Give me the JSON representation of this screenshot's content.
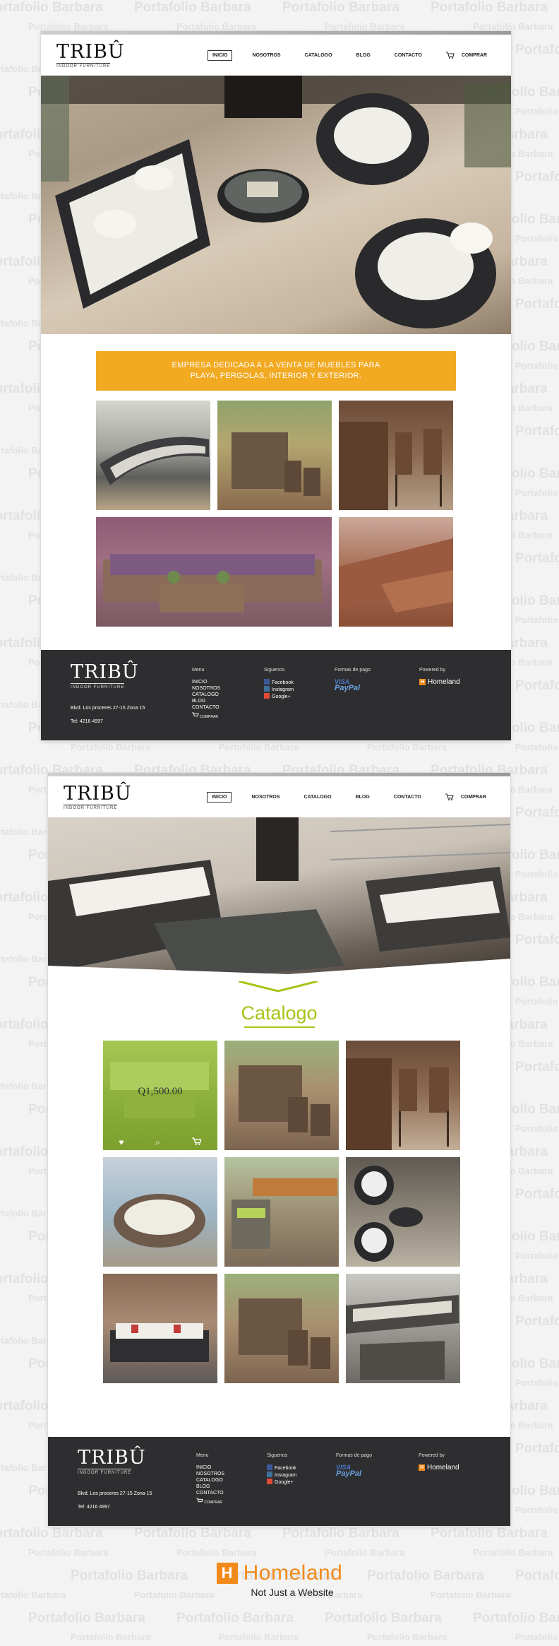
{
  "watermark_text": "Portafolio Barbara",
  "colors": {
    "accent_orange": "#f2aa23",
    "catalog_green": "#a8c316",
    "footer_bg": "#2e2e30",
    "homeland_orange": "#f28a1a"
  },
  "brand": {
    "logo": "TRIBÛ",
    "tagline": "INDOOR FURNITURE"
  },
  "nav": {
    "items": [
      "INICIO",
      "NOSOTROS",
      "CATALOGO",
      "BLOG",
      "CONTACTO"
    ],
    "cart_label": "COMPRAR",
    "cart_icon": "cart-icon"
  },
  "page1": {
    "banner_line1": "EMPRESA DEDICADA A LA VENTA DE MUEBLES PARA",
    "banner_line2": "PLAYA, PERGOLAS, INTERIOR Y EXTERIOR."
  },
  "footer": {
    "address": "Blvd. Los proceres 27-15 Zona 15",
    "phone": "Tel: 4216 4997",
    "menu_title": "Menu",
    "menu_items": [
      "INICIO",
      "NOSOTROS",
      "CATALOGO",
      "BLOG",
      "CONTACTO"
    ],
    "cart_label": "COMPRAR",
    "social_title": "Siguenos",
    "social": [
      "Facebook",
      "Instagram",
      "Google+"
    ],
    "payment_title": "Formas de pago",
    "payment": [
      "VISA",
      "PayPal"
    ],
    "powered_title": "Powered by",
    "powered_brand": "Homeland",
    "powered_box": "H"
  },
  "page2": {
    "catalog_title": "Catalogo",
    "featured_price": "Q1,500.00",
    "product_actions": [
      "heart-icon",
      "search-icon",
      "cart-icon"
    ]
  },
  "homeland_logo": {
    "box": "H",
    "name": "Homeland",
    "tagline": "Not Just a Website"
  }
}
